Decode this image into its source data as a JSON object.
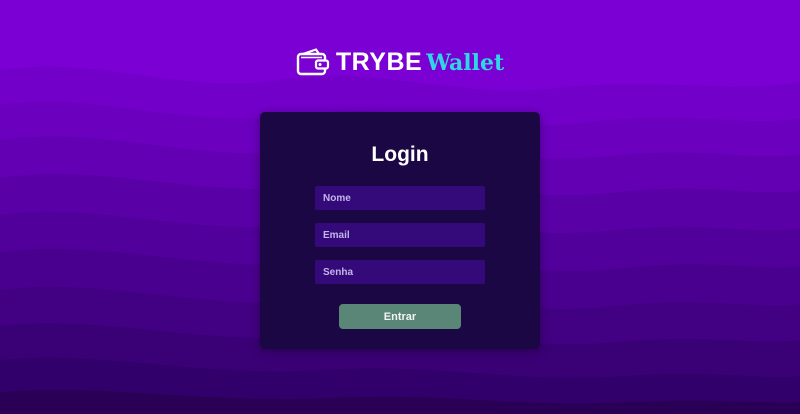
{
  "logo": {
    "brand_primary": "TRYBE",
    "brand_secondary": "Wallet",
    "icon": "wallet-icon"
  },
  "login": {
    "title": "Login",
    "name_placeholder": "Nome",
    "name_value": "",
    "email_placeholder": "Email",
    "email_value": "",
    "password_placeholder": "Senha",
    "password_value": "",
    "submit_label": "Entrar"
  },
  "colors": {
    "background_top": "#7a00d4",
    "background_bottom": "#2a0056",
    "card": "#1c0745",
    "input": "#340a7a",
    "button": "#5a8678",
    "brand_accent": "#2fd7e6"
  }
}
